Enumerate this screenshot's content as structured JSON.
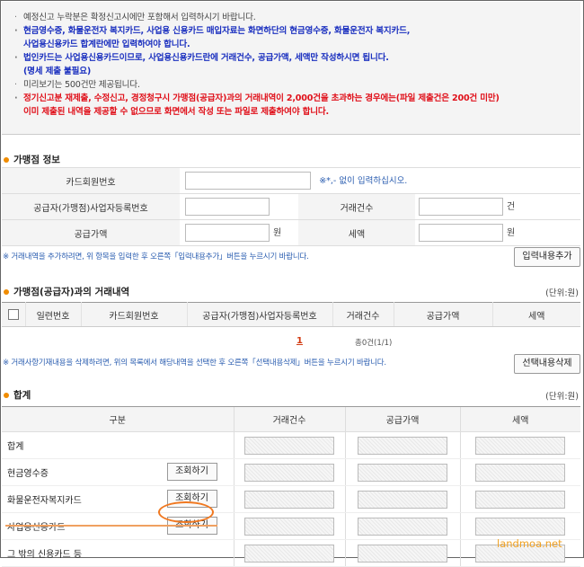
{
  "notices": [
    {
      "text": "예정신고 누락분은 확정신고시에만 포함해서 입력하시기 바랍니다.",
      "style": "black"
    },
    {
      "text": "현금영수증, 화물운전자 복지카드, 사업용 신용카드 매입자료는 화면하단의 현금영수증, 화물운전자 복지카드,",
      "style": "blue"
    },
    {
      "text": "사업용신용카드 합계란에만 입력하여야 합니다.",
      "style": "blue",
      "cont": true
    },
    {
      "text": "법인카드는 사업용신용카드이므로, 사업용신용카드란에 거래건수, 공급가액, 세액만 작성하시면 됩니다.",
      "style": "blue"
    },
    {
      "text": "(명세 제출 불필요)",
      "style": "blue",
      "cont": true
    },
    {
      "text": "미리보기는 500건만 제공됩니다.",
      "style": "black"
    },
    {
      "text": "정기신고분 재제출, 수정신고, 경정청구시 가맹점(공급자)과의 거래내역이 2,000건을 초과하는 경우에는(파일 제출건은 200건 미만)",
      "style": "red"
    },
    {
      "text": "이미 제출된 내역을 제공할 수 없으므로 화면에서 작성 또는 파일로 제출하여야 합니다.",
      "style": "red",
      "cont": true
    }
  ],
  "merchant": {
    "title": "가맹점 정보",
    "card_no_label": "카드회원번호",
    "card_no_hint": "※*,- 없이 입력하십시오.",
    "biz_no_label": "공급자(가맹점)사업자등록번호",
    "count_label": "거래건수",
    "count_unit": "건",
    "supply_label": "공급가액",
    "supply_unit": "원",
    "tax_label": "세액",
    "tax_unit": "원"
  },
  "add_guide": "※ 거래내역을 추가하려면, 위 항목을 입력한 후 오른쪽「입력내용추가」버튼을 누르시기 바랍니다.",
  "add_button": "입력내용추가",
  "trade": {
    "title": "가맹점(공급자)과의 거래내역",
    "unit": "(단위:원)",
    "columns": [
      "일련번호",
      "카드회원번호",
      "공급자(가맹점)사업자등록번호",
      "거래건수",
      "공급가액",
      "세액"
    ]
  },
  "pager": {
    "page": "1",
    "info": "총0건(1/1)"
  },
  "delete_guide": "※ 거래사항기재내용을 삭제하려면, 위의 목록에서 해당내역을 선택한 후 오른쪽「선택내용삭제」버튼을 누르시기 바랍니다.",
  "delete_button": "선택내용삭제",
  "total": {
    "title": "합계",
    "unit": "(단위:원)",
    "columns": [
      "구분",
      "거래건수",
      "공급가액",
      "세액"
    ],
    "rows": [
      {
        "name": "합계",
        "button": ""
      },
      {
        "name": "현금영수증",
        "button": "조회하기"
      },
      {
        "name": "화물운전자복지카드",
        "button": "조회하기"
      },
      {
        "name": "사업용신용카드",
        "button": "조회하기"
      },
      {
        "name": "그 밖의 신용카드 등",
        "button": ""
      }
    ]
  },
  "watermark": "landmoa.net",
  "colors": {
    "accent": "#f07820",
    "notice_blue": "#1a2fbf",
    "notice_red": "#e0101a",
    "hint_blue": "#2a5db0"
  }
}
